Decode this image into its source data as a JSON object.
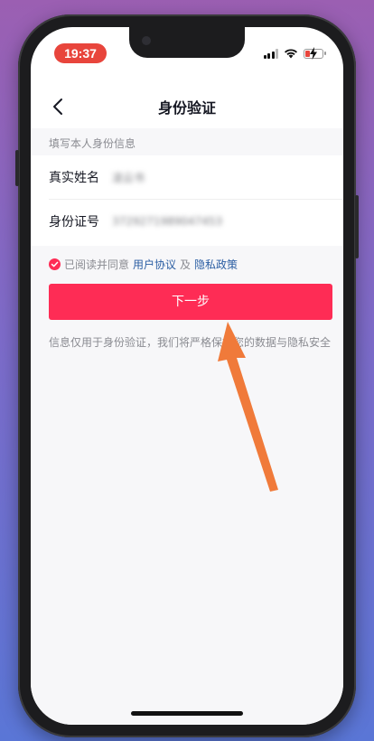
{
  "status_bar": {
    "time": "19:37",
    "icons": [
      "signal-icon",
      "wifi-icon",
      "battery-charging-icon"
    ],
    "time_pill_color": "#e8453c"
  },
  "nav": {
    "back_icon": "chevron-left-icon",
    "title": "身份验证"
  },
  "form": {
    "section_hint": "填写本人身份信息",
    "name_label": "真实姓名",
    "name_value": "凌云书",
    "id_label": "身份证号",
    "id_value": "3729271989047453"
  },
  "agreement": {
    "checked": true,
    "prefix": "已阅读并同意",
    "user_agreement": "用户协议",
    "joiner": "及",
    "privacy_policy": "隐私政策"
  },
  "next_button": {
    "label": "下一步",
    "color": "#fe2c55"
  },
  "footnote": "信息仅用于身份验证，我们将严格保护您的数据与隐私安全",
  "annotation": {
    "icon": "orange-arrow-icon",
    "color": "#f07a3a"
  }
}
